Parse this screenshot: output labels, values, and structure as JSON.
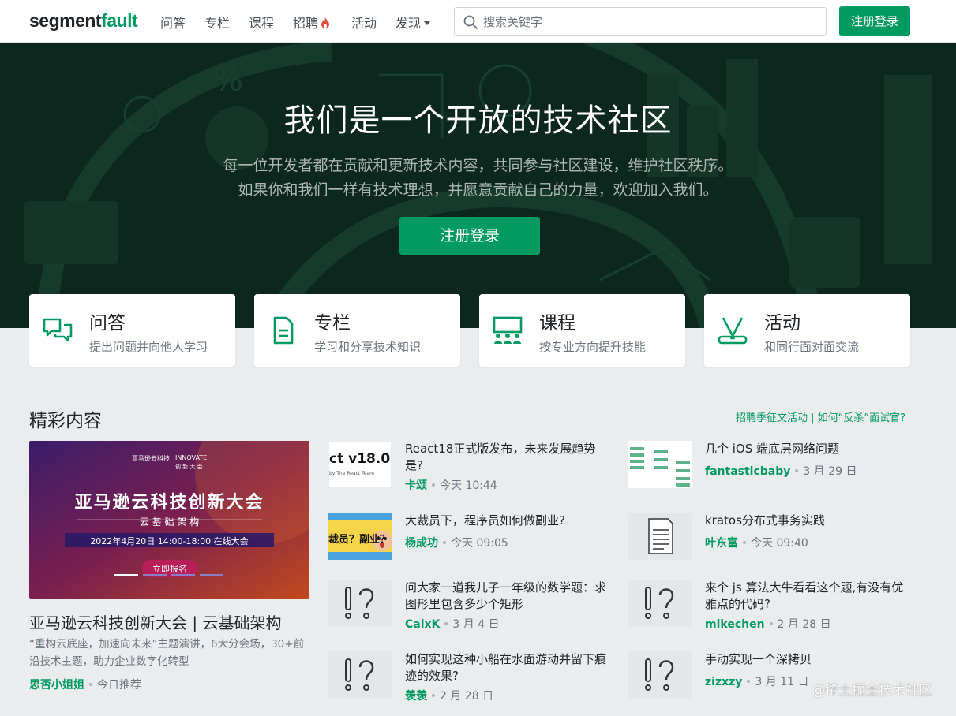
{
  "nav": {
    "logo_a": "segment",
    "logo_b": "fault",
    "links": [
      "问答",
      "专栏",
      "课程",
      "招聘",
      "活动",
      "发现"
    ],
    "search_placeholder": "搜索关键字",
    "auth_button": "注册登录"
  },
  "hero": {
    "title": "我们是一个开放的技术社区",
    "sub1": "每一位开发者都在贡献和更新技术内容，共同参与社区建设，维护社区秩序。",
    "sub2": "如果你和我们一样有技术理想，并愿意贡献自己的力量，欢迎加入我们。",
    "button": "注册登录"
  },
  "features": [
    {
      "title": "问答",
      "desc": "提出问题并向他人学习",
      "icon": "chat-icon"
    },
    {
      "title": "专栏",
      "desc": "学习和分享技术知识",
      "icon": "document-icon"
    },
    {
      "title": "课程",
      "desc": "按专业方向提升技能",
      "icon": "classroom-icon"
    },
    {
      "title": "活动",
      "desc": "和同行面对面交流",
      "icon": "activity-icon"
    }
  ],
  "section": {
    "title": "精彩内容",
    "links": "招聘季征文活动 | 如何“反杀”面试官?"
  },
  "featured": {
    "banner_brand": "INNOVATE",
    "banner_brand_sub": "创 新 大 会",
    "banner_org": "亚马逊云科技",
    "banner_title": "亚马逊云科技创新大会",
    "banner_sub": "云 基 础 架 构",
    "banner_date": "2022年4月20日  14:00-18:00  在线大会",
    "banner_button": "立即报名",
    "title": "亚马逊云科技创新大会 | 云基础架构",
    "desc": "“重构云底座，加速向未来”主题演讲，6大分会场，30+前沿技术主题，助力企业数字化转型",
    "author": "思否小姐姐",
    "time": "今日推荐"
  },
  "articles": [
    {
      "title": "React18正式版发布，未来发展趋势是?",
      "author": "卡颂",
      "time": "今天 10:44",
      "thumb_text": "ct v18.0",
      "thumb_sub": "by The React Team"
    },
    {
      "title": "大裁员下，程序员如何做副业?",
      "author": "杨成功",
      "time": "今天 09:05",
      "thumb_text": "裁员？副业？"
    },
    {
      "title": "问大家一道我儿子一年级的数学题：求图形里包含多少个矩形",
      "author": "CaixK",
      "time": "3 月 4 日"
    },
    {
      "title": "如何实现这种小船在水面游动并留下痕迹的效果?",
      "author": "羡羡",
      "time": "2 月 28 日"
    },
    {
      "title": "几个 iOS 端底层网络问题",
      "author": "fantasticbaby",
      "time": "3 月 29 日"
    },
    {
      "title": "kratos分布式事务实践",
      "author": "叶东富",
      "time": "今天 09:40"
    },
    {
      "title": "来个 js 算法大牛看看这个题,有没有优雅点的代码?",
      "author": "mikechen",
      "time": "2 月 28 日"
    },
    {
      "title": "手动实现一个深拷贝",
      "author": "zizxzy",
      "time": "3 月 11 日"
    }
  ],
  "watermark": "@稀土掘金技术社区",
  "colors": {
    "brand": "#019a61",
    "hero_bg": "#0d2a20"
  }
}
